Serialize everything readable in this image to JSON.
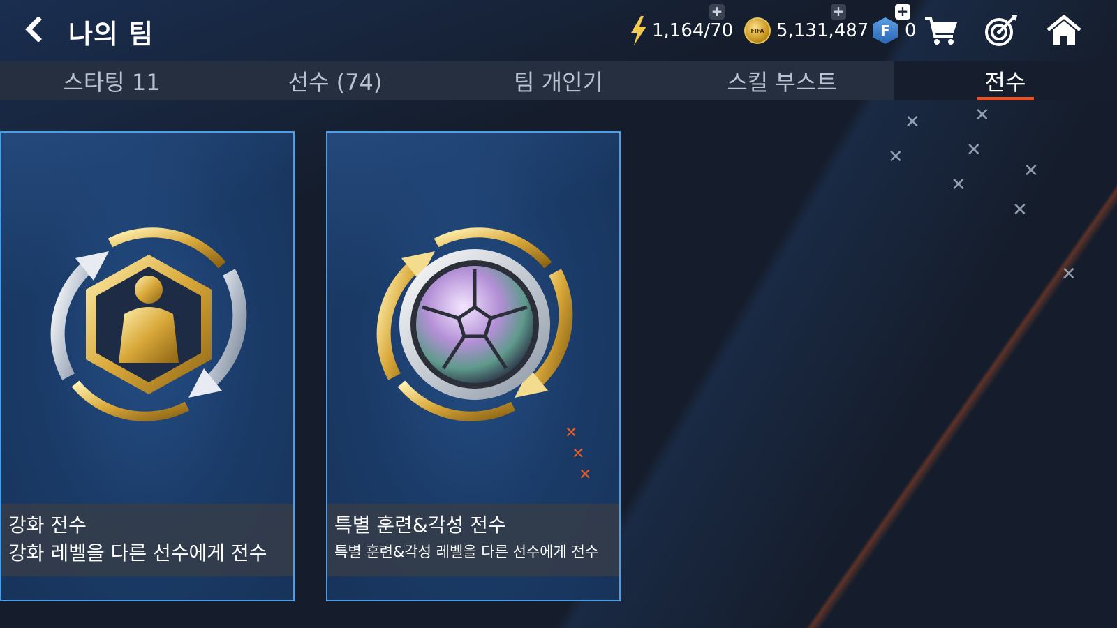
{
  "header": {
    "title": "나의 팀"
  },
  "currencies": {
    "energy": "1,164/70",
    "coins": "5,131,487",
    "fifa_points": "0",
    "coin_icon_text": "FIFA"
  },
  "tabs": [
    {
      "label": "스타팅 11"
    },
    {
      "label": "선수 (74)"
    },
    {
      "label": "팀 개인기"
    },
    {
      "label": "스킬 부스트"
    },
    {
      "label": "전수"
    }
  ],
  "active_tab": "전수",
  "cards": [
    {
      "title": "강화 전수",
      "description": "강화 레벨을 다른 선수에게 전수"
    },
    {
      "title": "특별 훈련&각성 전수",
      "description": "특별 훈련&각성 레벨을 다른 선수에게 전수"
    }
  ],
  "icons": {
    "back": "back-arrow-icon",
    "energy": "lightning-icon",
    "coin": "coin-icon",
    "fifa_point": "f-point-icon",
    "shop": "cart-icon",
    "objectives": "target-icon",
    "home": "home-icon"
  },
  "colors": {
    "accent": "#e4522a",
    "card_border": "#4d9ee6",
    "tab_bar": "#252f40"
  }
}
